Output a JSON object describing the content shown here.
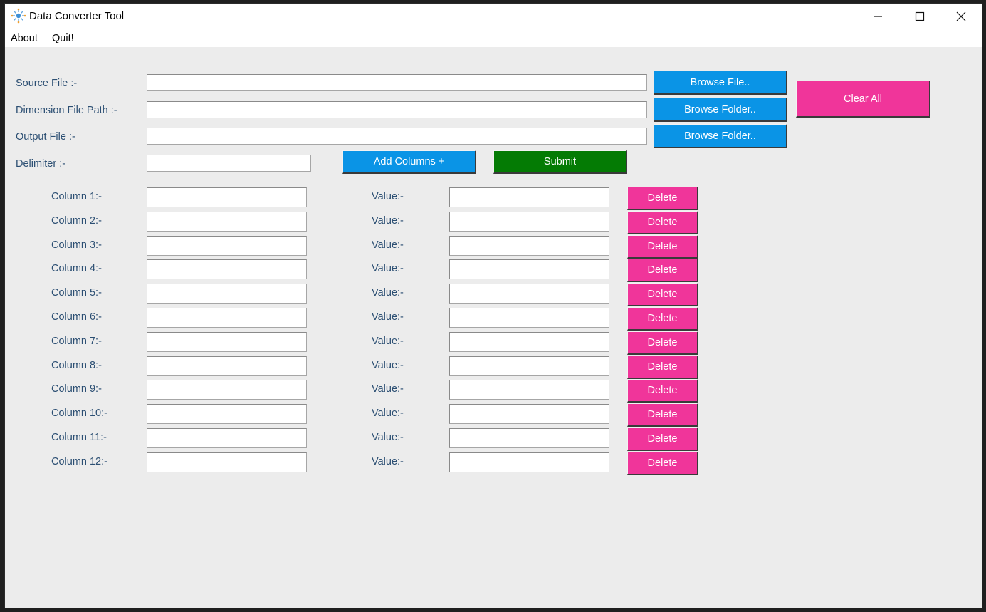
{
  "window": {
    "title": "Data Converter Tool",
    "controls": {
      "minimize": "—",
      "maximize": "☐",
      "close": "✕"
    }
  },
  "menu": {
    "about": "About",
    "quit": "Quit!"
  },
  "form": {
    "source_label": "Source File :-",
    "dimension_label": "Dimension File Path :-",
    "output_label": "Output File :-",
    "delimiter_label": "Delimiter :-",
    "source_value": "",
    "dimension_value": "",
    "output_value": "",
    "delimiter_value": "",
    "browse_file": "Browse File..",
    "browse_folder_1": "Browse Folder..",
    "browse_folder_2": "Browse Folder..",
    "clear_all": "Clear All",
    "add_columns": "Add Columns +",
    "submit": "Submit"
  },
  "columns": [
    {
      "label": "Column 1:-",
      "value_label": "Value:-",
      "delete": "Delete"
    },
    {
      "label": "Column 2:-",
      "value_label": "Value:-",
      "delete": "Delete"
    },
    {
      "label": "Column 3:-",
      "value_label": "Value:-",
      "delete": "Delete"
    },
    {
      "label": "Column 4:-",
      "value_label": "Value:-",
      "delete": "Delete"
    },
    {
      "label": "Column 5:-",
      "value_label": "Value:-",
      "delete": "Delete"
    },
    {
      "label": "Column 6:-",
      "value_label": "Value:-",
      "delete": "Delete"
    },
    {
      "label": "Column 7:-",
      "value_label": "Value:-",
      "delete": "Delete"
    },
    {
      "label": "Column 8:-",
      "value_label": "Value:-",
      "delete": "Delete"
    },
    {
      "label": "Column 9:-",
      "value_label": "Value:-",
      "delete": "Delete"
    },
    {
      "label": "Column 10:-",
      "value_label": "Value:-",
      "delete": "Delete"
    },
    {
      "label": "Column 11:-",
      "value_label": "Value:-",
      "delete": "Delete"
    },
    {
      "label": "Column 12:-",
      "value_label": "Value:-",
      "delete": "Delete"
    }
  ],
  "colors": {
    "blue_button": "#0a94e6",
    "pink_button": "#f0359a",
    "green_button": "#047b04",
    "label_text": "#2c4f73",
    "window_bg": "#ececec"
  }
}
